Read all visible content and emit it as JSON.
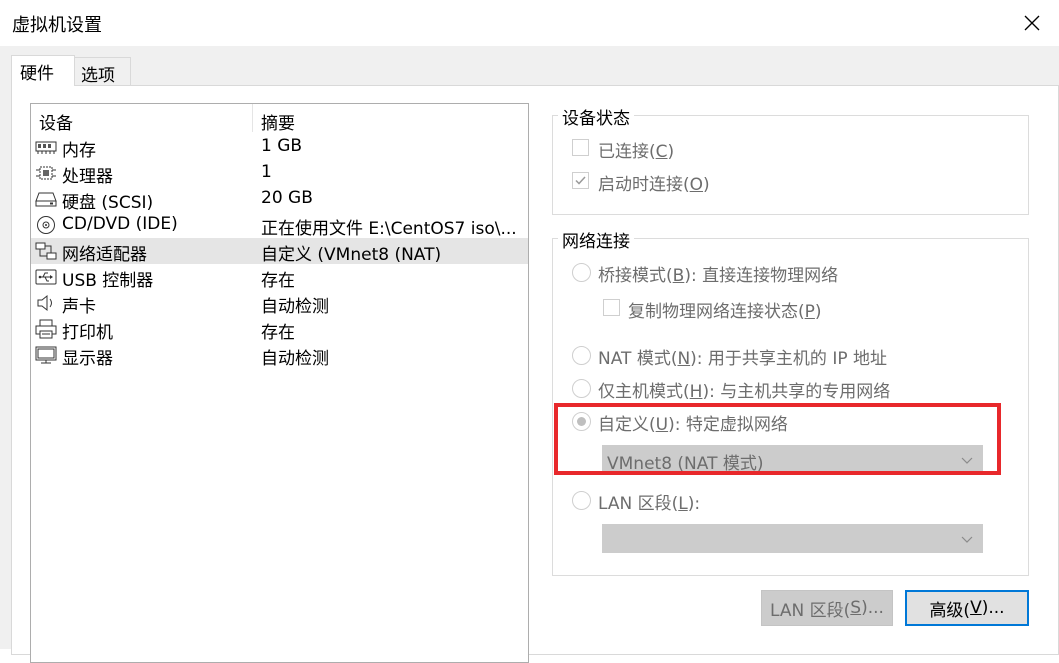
{
  "window": {
    "title": "虚拟机设置",
    "close_icon": "close-icon"
  },
  "tabs": [
    {
      "label": "硬件",
      "active": true
    },
    {
      "label": "选项",
      "active": false
    }
  ],
  "device_list": {
    "columns": [
      "设备",
      "摘要"
    ],
    "rows": [
      {
        "icon": "memory-icon",
        "name": "内存",
        "summary": "1 GB",
        "selected": false
      },
      {
        "icon": "processor-icon",
        "name": "处理器",
        "summary": "1",
        "selected": false
      },
      {
        "icon": "hard-disk-icon",
        "name": "硬盘 (SCSI)",
        "summary": "20 GB",
        "selected": false
      },
      {
        "icon": "cd-dvd-icon",
        "name": "CD/DVD (IDE)",
        "summary": "正在使用文件 E:\\CentOS7 iso\\...",
        "selected": false
      },
      {
        "icon": "network-adapter-icon",
        "name": "网络适配器",
        "summary": "自定义 (VMnet8 (NAT)",
        "selected": true
      },
      {
        "icon": "usb-icon",
        "name": "USB 控制器",
        "summary": "存在",
        "selected": false
      },
      {
        "icon": "sound-card-icon",
        "name": "声卡",
        "summary": "自动检测",
        "selected": false
      },
      {
        "icon": "printer-icon",
        "name": "打印机",
        "summary": "存在",
        "selected": false
      },
      {
        "icon": "display-icon",
        "name": "显示器",
        "summary": "自动检测",
        "selected": false
      }
    ]
  },
  "device_status": {
    "title": "设备状态",
    "connected": {
      "pre": "已连接(",
      "key": "C",
      "post": ")",
      "checked": false
    },
    "connect_at_power_on": {
      "pre": "启动时连接(",
      "key": "O",
      "post": ")",
      "checked": true
    }
  },
  "network_connection": {
    "title": "网络连接",
    "bridged": {
      "pre": "桥接模式(",
      "key": "B",
      "post": "): 直接连接物理网络",
      "selected": false
    },
    "replicate": {
      "pre": "复制物理网络连接状态(",
      "key": "P",
      "post": ")",
      "checked": false
    },
    "nat": {
      "pre": "NAT 模式(",
      "key": "N",
      "post": "): 用于共享主机的 IP 地址",
      "selected": false
    },
    "host_only": {
      "pre": "仅主机模式(",
      "key": "H",
      "post": "): 与主机共享的专用网络",
      "selected": false
    },
    "custom": {
      "pre": "自定义(",
      "key": "U",
      "post": "): 特定虚拟网络",
      "selected": true
    },
    "custom_value": "VMnet8 (NAT 模式)",
    "lan_segment": {
      "pre": "LAN 区段(",
      "key": "L",
      "post": "):",
      "selected": false
    },
    "lan_segment_value": ""
  },
  "buttons": {
    "lan_segments": {
      "pre": "LAN 区段(",
      "key": "S",
      "post": ")..."
    },
    "advanced": {
      "pre": "高级(",
      "key": "V",
      "post": ")..."
    }
  },
  "colors": {
    "highlight": "#e8282b",
    "focus_border": "#0078d7"
  }
}
